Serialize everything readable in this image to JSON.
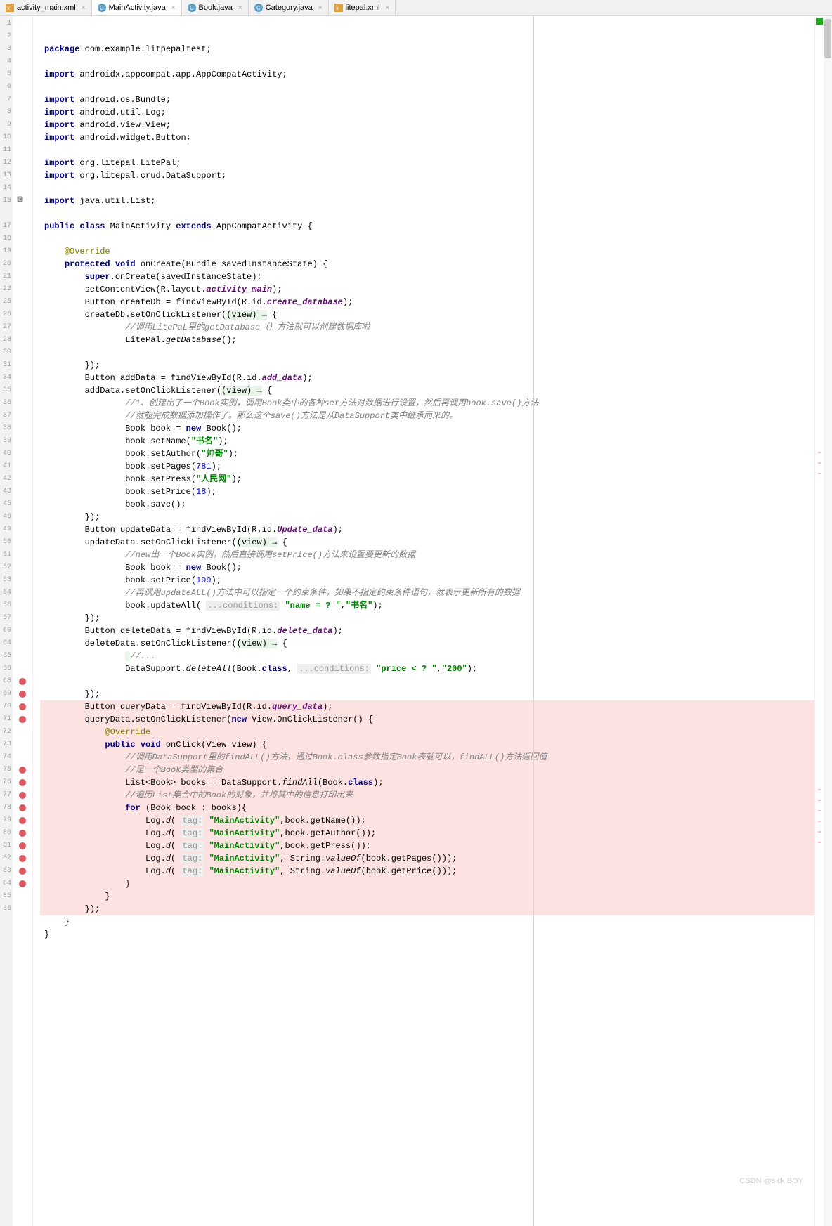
{
  "tabs": [
    {
      "icon": "xml",
      "label": "activity_main.xml"
    },
    {
      "icon": "java",
      "label": "MainActivity.java",
      "active": true
    },
    {
      "icon": "java",
      "label": "Book.java"
    },
    {
      "icon": "java",
      "label": "Category.java"
    },
    {
      "icon": "xml",
      "label": "litepal.xml"
    }
  ],
  "gutter": [
    "1",
    "2",
    "3",
    "4",
    "5",
    "6",
    "7",
    "8",
    "9",
    "10",
    "11",
    "12",
    "13",
    "14",
    "15",
    "",
    "17",
    "18",
    "19",
    "20",
    "21",
    "22",
    "25",
    "26",
    "27",
    "28",
    "30",
    "31",
    "34",
    "35",
    "36",
    "37",
    "38",
    "39",
    "40",
    "41",
    "42",
    "43",
    "45",
    "46",
    "49",
    "50",
    "51",
    "52",
    "53",
    "54",
    "56",
    "57",
    "60",
    "64",
    "65",
    "66",
    "68",
    "69",
    "70",
    "71",
    "72",
    "73",
    "74",
    "75",
    "76",
    "77",
    "78",
    "79",
    "80",
    "81",
    "82",
    "83",
    "84",
    "85",
    "86"
  ],
  "breakpoints": [
    53,
    54,
    55,
    56,
    60,
    61,
    62,
    63,
    64,
    65,
    66,
    67,
    68,
    69
  ],
  "code": {
    "l1": {
      "kw": "package",
      "r": " com.example.litpepaltest;"
    },
    "l3": {
      "kw": "import",
      "r": " androidx.appcompat.app.AppCompatActivity;"
    },
    "l5": {
      "kw": "import",
      "r": " android.os.Bundle;"
    },
    "l6": {
      "kw": "import",
      "r": " android.util.Log;"
    },
    "l7": {
      "kw": "import",
      "r": " android.view.View;"
    },
    "l8": {
      "kw": "import",
      "r": " android.widget.Button;"
    },
    "l10": {
      "kw": "import",
      "r": " org.litepal.LitePal;"
    },
    "l11": {
      "kw": "import",
      "r": " org.litepal.crud.DataSupport;"
    },
    "l13": {
      "kw": "import",
      "r": " java.util.List;"
    },
    "l15": {
      "k1": "public",
      "k2": "class",
      "cls": "MainActivity",
      "k3": "extends",
      "sup": "AppCompatActivity",
      "oc": "{"
    },
    "l17": {
      "ann": "@Override"
    },
    "l18": {
      "k1": "protected",
      "k2": "void",
      "m": "onCreate",
      "sig": "(Bundle savedInstanceState) {"
    },
    "l19": {
      "kw": "super",
      "r": ".onCreate(savedInstanceState);"
    },
    "l20": {
      "a": "setContentView(R.layout.",
      "f": "activity_main",
      "b": ");"
    },
    "l21": {
      "a": "Button createDb = findViewById(R.id.",
      "f": "create_database",
      "b": ");"
    },
    "l22": {
      "a": "createDb.setOnClickListener(",
      "lam": "(view) →",
      "b": " {"
    },
    "l25": {
      "cmt": "//调用LitePaL里的getDatabase（）方法就可以创建数据库啦"
    },
    "l26": {
      "a": "LitePal.",
      "m": "getDatabase",
      "b": "();"
    },
    "l28": {
      "r": "});"
    },
    "l30": {
      "a": "Button addData = findViewById(R.id.",
      "f": "add_data",
      "b": ");"
    },
    "l31": {
      "a": "addData.setOnClickListener(",
      "lam": "(view) →",
      "b": " {"
    },
    "l34": {
      "cmt": "//1、创建出了一个Book实例，调用Book类中的各种set方法对数据进行设置，然后再调用book.save()方法"
    },
    "l35": {
      "cmt": "//就能完成数据添加操作了。那么这个save()方法是从DataSupport类中继承而来的。"
    },
    "l36": {
      "a": "Book book = ",
      "kw": "new",
      "b": " Book();"
    },
    "l37": {
      "a": "book.setName(",
      "s": "\"书名\"",
      "b": ");"
    },
    "l38": {
      "a": "book.setAuthor(",
      "s": "\"帅哥\"",
      "b": ");"
    },
    "l39": {
      "a": "book.setPages(",
      "n": "781",
      "b": ");"
    },
    "l40": {
      "a": "book.setPress(",
      "s": "\"人民网\"",
      "b": ");"
    },
    "l41": {
      "a": "book.setPrice(",
      "n": "18",
      "b": ");"
    },
    "l42": {
      "r": "book.save();"
    },
    "l43": {
      "r": "});"
    },
    "l45": {
      "a": "Button updateData = findViewById(R.id.",
      "f": "Update_data",
      "b": ");"
    },
    "l46": {
      "a": "updateData.setOnClickListener(",
      "lam": "(view) →",
      "b": " {"
    },
    "l49": {
      "cmt": "//new出一个Book实例，然后直接调用setPrice()方法来设置要更新的数据"
    },
    "l50": {
      "a": "Book book = ",
      "kw": "new",
      "b": " Book();"
    },
    "l51": {
      "a": "book.setPrice(",
      "n": "199",
      "b": ");"
    },
    "l52": {
      "cmt": "//再调用updateALL()方法中可以指定一个约束条件，如果不指定约束条件语句，就表示更新所有的数据"
    },
    "l53": {
      "a": "book.updateAll( ",
      "h": "...conditions:",
      "s1": "\"name = ? \"",
      "c": ",",
      "s2": "\"书名\"",
      "b": ");"
    },
    "l54": {
      "r": "});"
    },
    "l56": {
      "a": "Button deleteData = findViewById(R.id.",
      "f": "delete_data",
      "b": ");"
    },
    "l57": {
      "a": "deleteData.setOnClickListener(",
      "lam": "(view) →",
      "b": " {"
    },
    "l60": {
      "cmt": "//..."
    },
    "l64": {
      "a": "DataSupport.",
      "m": "deleteAll",
      "c": "(Book.",
      "kw": "class",
      "d": ", ",
      "h": "...conditions:",
      "s1": "\"price < ? \"",
      "e": ",",
      "s2": "\"200\"",
      "b": ");"
    },
    "l66": {
      "r": "});"
    },
    "l68": {
      "a": "Button queryData = findViewById(R.id.",
      "f": "query_data",
      "b": ");"
    },
    "l69": {
      "a": "queryData.setOnClickListener(",
      "kw": "new",
      "b": " View.OnClickListener() {"
    },
    "l70": {
      "ann": "@Override"
    },
    "l71": {
      "k1": "public",
      "k2": "void",
      "m": "onClick",
      "sig": "(View view) {"
    },
    "l72": {
      "cmt": "//调用DataSupport里的findALL()方法，通过Book.class参数指定Book表就可以，findALL()方法返回值"
    },
    "l73": {
      "cmt": "//是一个Book类型的集合"
    },
    "l74": {
      "a": "List<Book> books = DataSupport.",
      "m": "findAll",
      "b": "(Book.",
      "kw": "class",
      "c": ");"
    },
    "l75": {
      "cmt": "//遍历List集合中的Book的对象，并将其中的信息打印出来"
    },
    "l76": {
      "kw": "for",
      "r": " (Book book : books){"
    },
    "l77": {
      "a": "Log.",
      "m": "d",
      "b": "( ",
      "h": "tag:",
      "s": "\"MainActivity\"",
      "c": ",book.getName());"
    },
    "l78": {
      "a": "Log.",
      "m": "d",
      "b": "( ",
      "h": "tag:",
      "s": "\"MainActivity\"",
      "c": ",book.getAuthor());"
    },
    "l79": {
      "a": "Log.",
      "m": "d",
      "b": "( ",
      "h": "tag:",
      "s": "\"MainActivity\"",
      "c": ",book.getPress());"
    },
    "l80": {
      "a": "Log.",
      "m": "d",
      "b": "( ",
      "h": "tag:",
      "s": "\"MainActivity\"",
      "c": ", String.",
      "m2": "valueOf",
      "d": "(book.getPages()));"
    },
    "l81": {
      "a": "Log.",
      "m": "d",
      "b": "( ",
      "h": "tag:",
      "s": "\"MainActivity\"",
      "c": ", String.",
      "m2": "valueOf",
      "d": "(book.getPrice()));"
    },
    "l82": {
      "r": "}"
    },
    "l83": {
      "r": "}"
    },
    "l84": {
      "r": "});"
    },
    "l85": {
      "r": "}"
    },
    "l86": {
      "r": "}"
    }
  },
  "watermark": "CSDN @sick BOY"
}
